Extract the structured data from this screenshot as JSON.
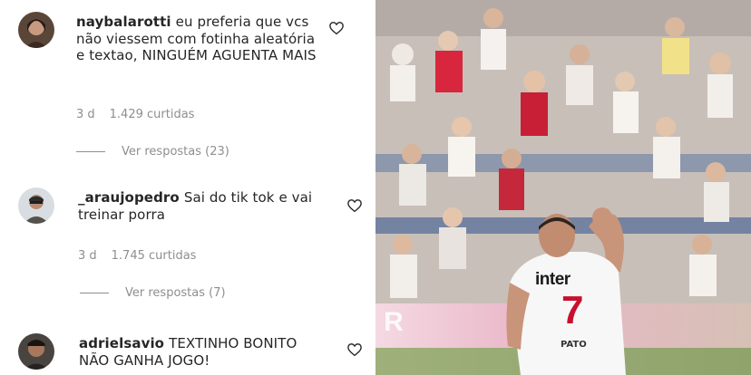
{
  "comments": [
    {
      "username": "naybalarotti",
      "text": "eu preferia que vcs não viessem com fotinha aleatória e textao, NINGUÉM AGUENTA MAIS",
      "time": "3 d",
      "likes": "1.429 curtidas",
      "replies": "Ver respostas (23)"
    },
    {
      "username": "_araujopedro",
      "text": "Sai do tik tok e vai treinar porra",
      "time": "3 d",
      "likes": "1.745 curtidas",
      "replies": "Ver respostas (7)"
    },
    {
      "username": "adrielsavio",
      "text": "TEXTINHO BONITO NÃO GANHA JOGO!",
      "time": "",
      "likes": "",
      "replies": ""
    }
  ],
  "photo": {
    "sponsor": "inter",
    "number": "7",
    "player": "PATO"
  },
  "colors": {
    "text": "#262626",
    "secondary": "#8e8e8e",
    "jersey_red": "#c8102e"
  },
  "icons": [
    "heart-icon"
  ]
}
